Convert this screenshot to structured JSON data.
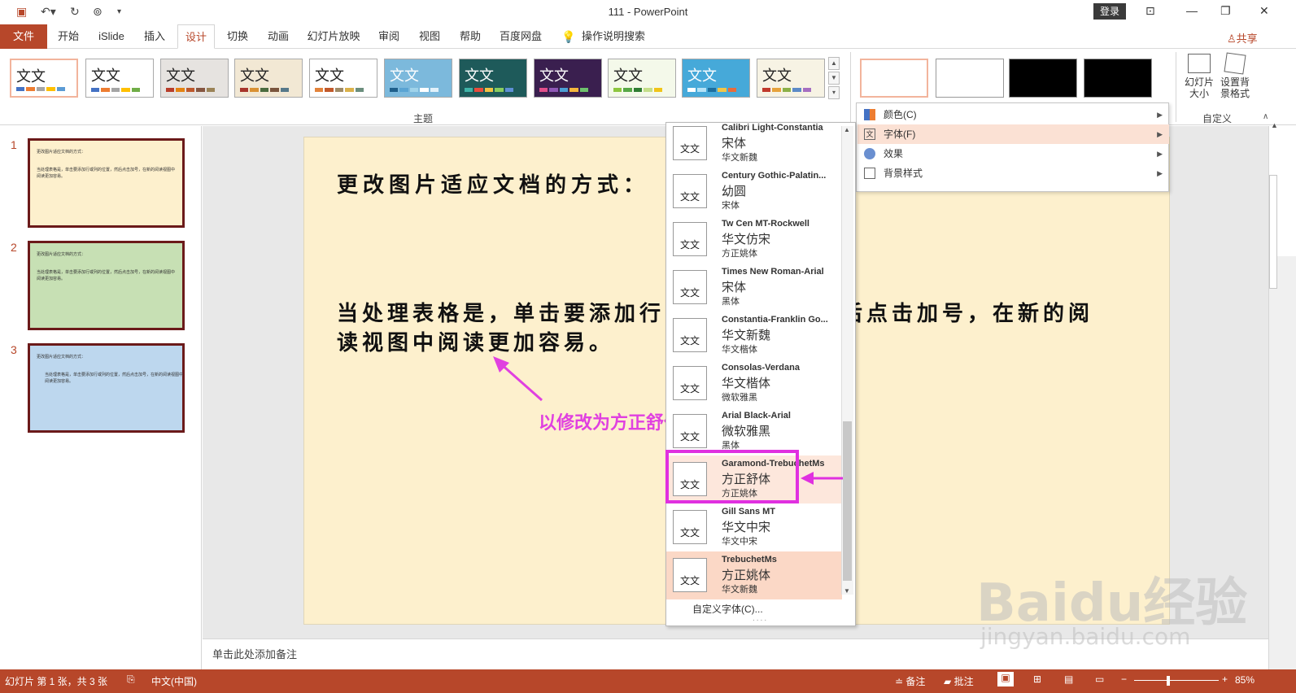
{
  "titlebar": {
    "title": "111  -  PowerPoint",
    "login": "登录"
  },
  "tabs": [
    "开始",
    "iSlide",
    "插入",
    "设计",
    "切换",
    "动画",
    "幻灯片放映",
    "审阅",
    "视图",
    "帮助",
    "百度网盘"
  ],
  "file_tab": "文件",
  "tell_me": "操作说明搜索",
  "share": "共享",
  "themes_label": "主题",
  "theme_text": "文文",
  "custom_group": {
    "label": "自定义",
    "size_btn": "幻灯片大小",
    "bg_btn": "设置背景格式"
  },
  "slide_numbers": [
    "1",
    "2",
    "3"
  ],
  "slide": {
    "title": "更改图片适应文档的方式：",
    "body": "当处理表格是，单击要添加行或列的位置，然后点击加号，在新的阅读视图中阅读更加容易。",
    "annotation": "以修改为方正舒体"
  },
  "notes_placeholder": "单击此处添加备注",
  "font_menu": {
    "items": [
      {
        "name": "Calibri Light-Constantia",
        "heading": "宋体",
        "body": "华文新魏"
      },
      {
        "name": "Century Gothic-Palatin...",
        "heading": "幼圆",
        "body": "宋体"
      },
      {
        "name": "Tw Cen MT-Rockwell",
        "heading": "华文仿宋",
        "body": "方正姚体"
      },
      {
        "name": "Times New Roman-Arial",
        "heading": "宋体",
        "body": "黑体"
      },
      {
        "name": "Constantia-Franklin Go...",
        "heading": "华文新魏",
        "body": "华文楷体"
      },
      {
        "name": "Consolas-Verdana",
        "heading": "华文楷体",
        "body": "微软雅黑"
      },
      {
        "name": "Arial Black-Arial",
        "heading": "微软雅黑",
        "body": "黑体"
      },
      {
        "name": "Garamond-TrebuchetMs",
        "heading": "方正舒体",
        "body": "方正姚体"
      },
      {
        "name": "Gill Sans MT",
        "heading": "华文中宋",
        "body": "华文中宋"
      },
      {
        "name": "TrebuchetMs",
        "heading": "方正姚体",
        "body": "华文新魏"
      }
    ],
    "sample": "文文",
    "custom": "自定义字体(C)..."
  },
  "variant_menu": {
    "items": [
      {
        "label": "颜色(C)"
      },
      {
        "label": "字体(F)"
      },
      {
        "label": "效果"
      },
      {
        "label": "背景样式"
      }
    ]
  },
  "statusbar": {
    "slide_info": "幻灯片 第 1 张，共 3 张",
    "language": "中文(中国)",
    "notes": "备注",
    "comments": "批注",
    "zoom": "85%"
  },
  "watermark": {
    "main": "Baidu经验",
    "sub": "jingyan.baidu.com"
  },
  "colors": {
    "accent": "#b7472a",
    "annotation": "#e040e0",
    "slide_bg": "#fdf0cd",
    "highlight": "#fbd8c6"
  }
}
